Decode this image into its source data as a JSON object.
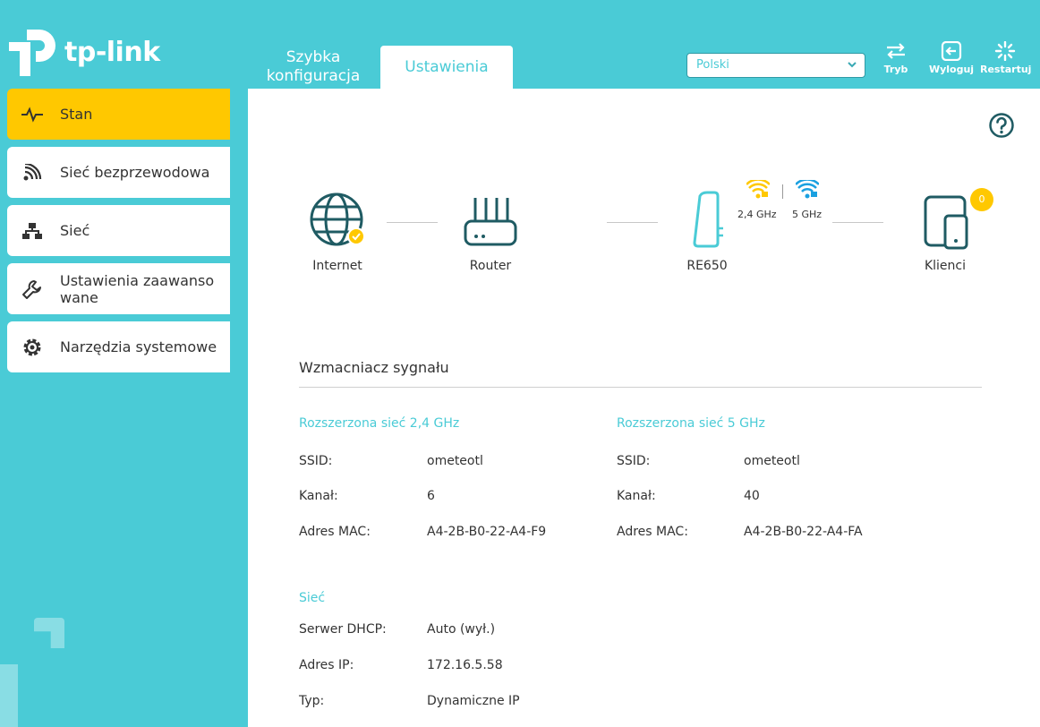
{
  "brand": {
    "logo_text": "tp-link",
    "accent": "#4acbd6",
    "active": "#ffc800"
  },
  "tabs": {
    "quick_setup": "Szybka konfiguracja",
    "settings": "Ustawienia"
  },
  "language": {
    "selected": "Polski"
  },
  "top_buttons": {
    "mode": "Tryb",
    "logout": "Wyloguj",
    "restart": "Restartuj"
  },
  "sidebar": {
    "items": [
      {
        "label": "Stan",
        "icon": "pulse-icon"
      },
      {
        "label": "Sieć bezprzewodowa",
        "icon": "wireless-icon"
      },
      {
        "label": "Sieć",
        "icon": "network-icon"
      },
      {
        "label": "Ustawienia zaawanso wane",
        "icon": "wrench-icon"
      },
      {
        "label": "Narzędzia systemowe",
        "icon": "gear-icon"
      }
    ]
  },
  "topology": {
    "internet": "Internet",
    "router": "Router",
    "extender": "RE650",
    "clients": "Klienci",
    "clients_count": "0",
    "band_24": "2,4 GHz",
    "band_5": "5 GHz"
  },
  "extender": {
    "title": "Wzmacniacz sygnału",
    "net24": {
      "heading": "Rozszerzona sieć 2,4 GHz",
      "ssid_label": "SSID:",
      "ssid": "ometeotl",
      "channel_label": "Kanał:",
      "channel": "6",
      "mac_label": "Adres MAC:",
      "mac": "A4-2B-B0-22-A4-F9"
    },
    "net5": {
      "heading": "Rozszerzona sieć 5 GHz",
      "ssid_label": "SSID:",
      "ssid": "ometeotl",
      "channel_label": "Kanał:",
      "channel": "40",
      "mac_label": "Adres MAC:",
      "mac": "A4-2B-B0-22-A4-FA"
    }
  },
  "network": {
    "heading": "Sieć",
    "dhcp_label": "Serwer DHCP:",
    "dhcp": "Auto (wył.)",
    "ip_label": "Adres IP:",
    "ip": "172.16.5.58",
    "type_label": "Typ:",
    "type": "Dynamiczne IP"
  }
}
